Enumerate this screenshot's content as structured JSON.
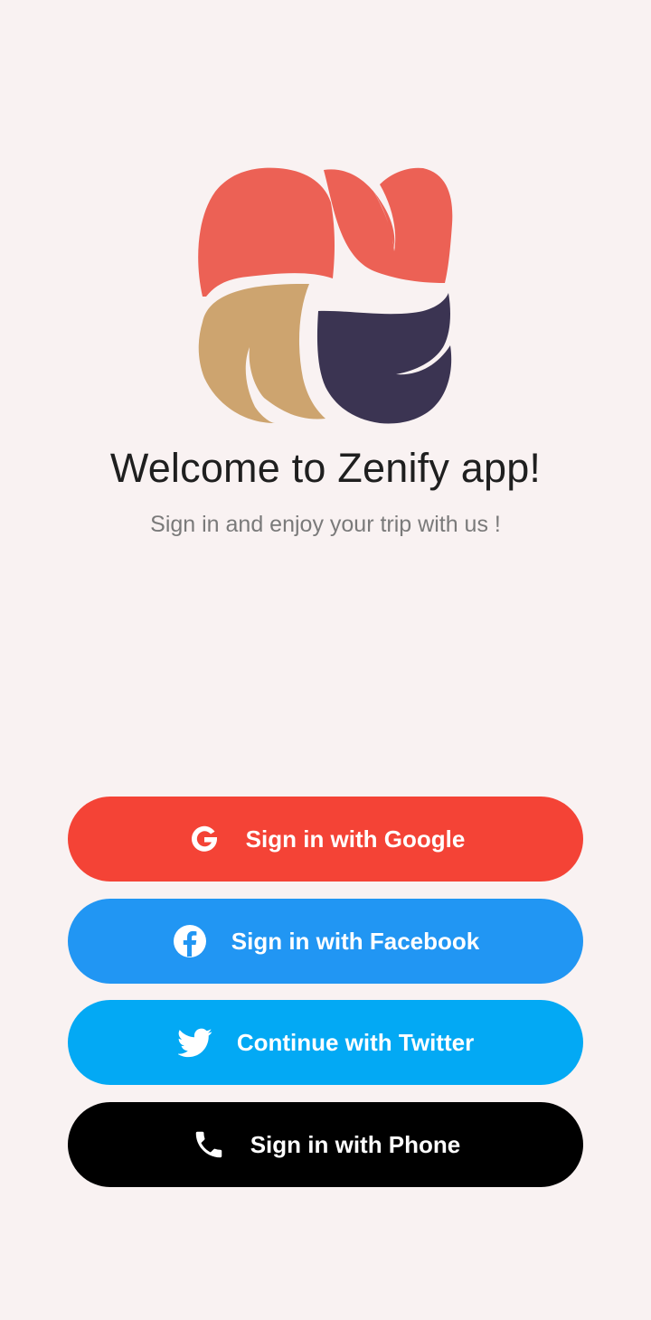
{
  "welcome": {
    "title": "Welcome to Zenify app!",
    "subtitle": "Sign in and enjoy your trip with us !"
  },
  "buttons": {
    "google": {
      "label": "Sign in with Google",
      "icon": "google-icon",
      "color": "#f44336"
    },
    "facebook": {
      "label": "Sign in with Facebook",
      "icon": "facebook-icon",
      "color": "#2196f3"
    },
    "twitter": {
      "label": "Continue with Twitter",
      "icon": "twitter-icon",
      "color": "#03a9f4"
    },
    "phone": {
      "label": "Sign in with Phone",
      "icon": "phone-icon",
      "color": "#000000"
    }
  },
  "logo": {
    "colors": {
      "coral": "#ec6155",
      "tan": "#cda46f",
      "navy": "#3b3452"
    }
  }
}
